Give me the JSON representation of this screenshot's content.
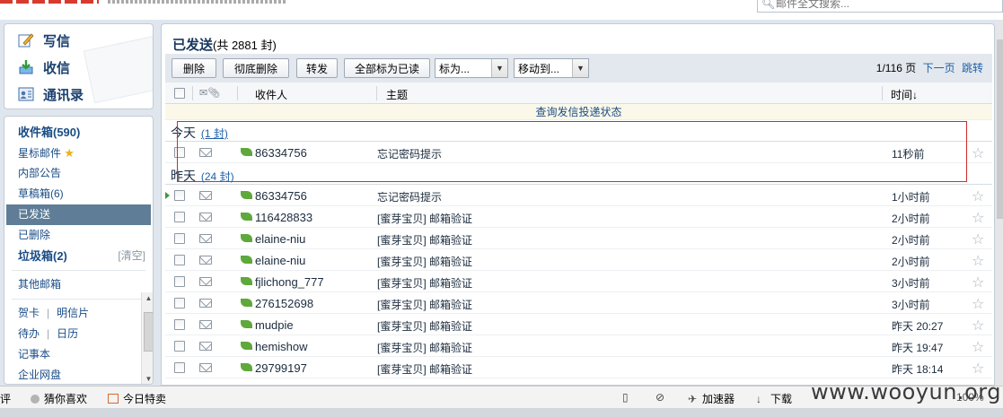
{
  "search": {
    "placeholder": "邮件全文搜索..."
  },
  "left": {
    "compose": "写信",
    "receive": "收信",
    "contacts": "通讯录",
    "folders": {
      "inbox": "收件箱(590)",
      "starred": "星标邮件",
      "internal": "内部公告",
      "drafts": "草稿箱(6)",
      "sent": "已发送",
      "deleted": "已删除",
      "spam": "垃圾箱(2)",
      "spam_clear": "[清空]",
      "other": "其他邮箱",
      "card": "贺卡",
      "postcard": "明信片",
      "todo": "待办",
      "calendar": "日历",
      "notes": "记事本",
      "cutoff": "企业网盘"
    }
  },
  "main": {
    "title": "已发送",
    "count": "(共 2881 封)",
    "toolbar": {
      "delete": "删除",
      "delete_perm": "彻底删除",
      "forward": "转发",
      "mark_all_read": "全部标为已读",
      "mark_as": "标为...",
      "move_to": "移动到..."
    },
    "pager": {
      "page": "1/116 页",
      "next": "下一页",
      "jump": "跳转"
    },
    "columns": {
      "receiver": "收件人",
      "subject": "主题",
      "time": "时间↓"
    },
    "tracking_link": "查询发信投递状态",
    "groups": [
      {
        "label": "今天",
        "count_link": "(1 封)"
      },
      {
        "label": "昨天",
        "count_link": "(24 封)"
      }
    ],
    "today_rows": [
      {
        "receiver": "86334756",
        "subject": "忘记密码提示",
        "time": "11秒前"
      }
    ],
    "yesterday_rows": [
      {
        "receiver": "86334756",
        "subject": "忘记密码提示",
        "time": "1小时前"
      },
      {
        "receiver": "116428833",
        "subject": "[蜜芽宝贝] 邮箱验证",
        "time": "2小时前"
      },
      {
        "receiver": "elaine-niu",
        "subject": "[蜜芽宝贝] 邮箱验证",
        "time": "2小时前"
      },
      {
        "receiver": "elaine-niu",
        "subject": "[蜜芽宝贝] 邮箱验证",
        "time": "2小时前"
      },
      {
        "receiver": "fjlichong_777",
        "subject": "[蜜芽宝贝] 邮箱验证",
        "time": "3小时前"
      },
      {
        "receiver": "276152698",
        "subject": "[蜜芽宝贝] 邮箱验证",
        "time": "3小时前"
      },
      {
        "receiver": "mudpie",
        "subject": "[蜜芽宝贝] 邮箱验证",
        "time": "昨天 20:27"
      },
      {
        "receiver": "hemishow",
        "subject": "[蜜芽宝贝] 邮箱验证",
        "time": "昨天 19:47"
      },
      {
        "receiver": "29799197",
        "subject": "[蜜芽宝贝] 邮箱验证",
        "time": "昨天 18:14"
      }
    ]
  },
  "statusbar": {
    "review": "评",
    "guess": "猜你喜欢",
    "today_deal": "今日特卖",
    "accelerator": "加速器",
    "download": "下载",
    "zoom": "100%"
  },
  "watermark": "www.wooyun.org"
}
